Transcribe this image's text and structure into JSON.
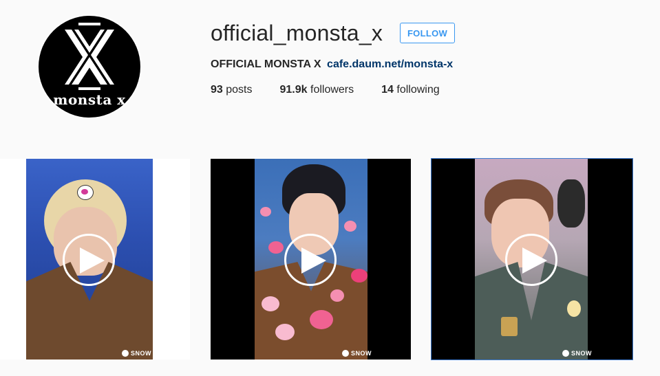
{
  "profile": {
    "username": "official_monsta_x",
    "follow_label": "FOLLOW",
    "full_name": "OFFICIAL MONSTA X",
    "website": "cafe.daum.net/monsta-x",
    "avatar_logo_text": "monsta x"
  },
  "stats": {
    "posts_count": "93",
    "posts_label": "posts",
    "followers_count": "91.9k",
    "followers_label": "followers",
    "following_count": "14",
    "following_label": "following"
  },
  "posts": [
    {
      "type": "video",
      "watermark": "SNOW",
      "icon": "play-icon"
    },
    {
      "type": "video",
      "watermark": "SNOW",
      "icon": "play-icon"
    },
    {
      "type": "video",
      "watermark": "SNOW",
      "icon": "play-icon"
    }
  ],
  "colors": {
    "accent": "#3897f0",
    "link": "#003569",
    "background": "#fafafa",
    "text": "#262626"
  }
}
